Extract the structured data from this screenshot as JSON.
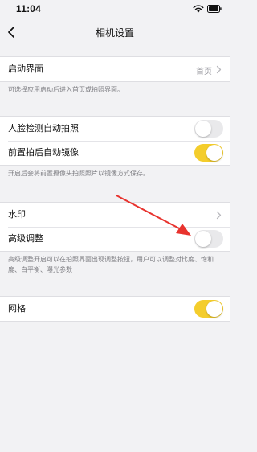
{
  "status_bar": {
    "time": "11:04",
    "icons": [
      "wifi-icon",
      "battery-icon"
    ]
  },
  "nav": {
    "title": "相机设置",
    "back_icon": "chevron-left-icon"
  },
  "sections": {
    "startup": {
      "label": "启动界面",
      "value": "首页",
      "note": "可选择应用启动后进入首页或拍照界面。"
    },
    "camera": {
      "face_detect_label": "人脸检测自动拍照",
      "face_detect_on": false,
      "mirror_label": "前置拍后自动镜像",
      "mirror_on": true,
      "note": "开启后会将前置摄像头拍照照片以镜像方式保存。"
    },
    "advanced": {
      "watermark_label": "水印",
      "advanced_label": "高级调整",
      "advanced_on": false,
      "note": "高级调整开启可以在拍照界面出现调整按钮，用户可以调整对比度、饱和度、白平衡、曝光参数"
    },
    "grid": {
      "label": "网格",
      "on": true
    }
  },
  "colors": {
    "toggle_on": "#f4cd2c",
    "toggle_off": "#e9e9eb",
    "annotation_arrow": "#e8332e",
    "background": "#f2f2f4"
  }
}
